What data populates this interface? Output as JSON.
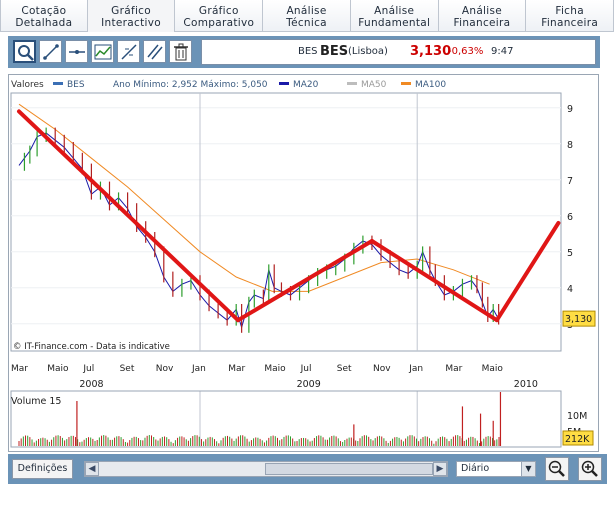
{
  "tabs": [
    {
      "line1": "Cotação",
      "line2": "Detalhada",
      "active": false
    },
    {
      "line1": "Gráfico",
      "line2": "Interactivo",
      "active": true
    },
    {
      "line1": "Gráfico",
      "line2": "Comparativo",
      "active": false
    },
    {
      "line1": "Análise",
      "line2": "Técnica",
      "active": false
    },
    {
      "line1": "Análise",
      "line2": "Fundamental",
      "active": false
    },
    {
      "line1": "Análise",
      "line2": "Financeira",
      "active": false
    },
    {
      "line1": "Ficha",
      "line2": "Financeira",
      "active": false
    }
  ],
  "toolbar": {
    "tools": [
      "zoom-icon",
      "trendline-icon",
      "horizontal-line-icon",
      "indicator-icon",
      "fibonacci-icon",
      "parallel-lines-icon",
      "trash-icon"
    ]
  },
  "quote": {
    "name": "BES",
    "ticker": "BES",
    "market": "(Lisboa)",
    "price": "3,130",
    "change": "-0,63%",
    "time": "9:47"
  },
  "legend": {
    "label": "Valores",
    "series": [
      {
        "name": "BES",
        "color": "#3b6fb5"
      },
      {
        "name": "Ano Mínimo: 2,952 Máximo: 5,050",
        "color": ""
      },
      {
        "name": "MA20",
        "color": "#1a1aa8"
      },
      {
        "name": "MA50",
        "color": "#bdbdbd"
      },
      {
        "name": "MA100",
        "color": "#f08a24"
      }
    ]
  },
  "watermark": "© IT-Finance.com - Data is indicative",
  "volume_label": "Volume 15",
  "price_tag": "3,130",
  "volume_tag": "212K",
  "chart_data": {
    "type": "line",
    "y_ticks": [
      "9",
      "8",
      "7",
      "6",
      "5",
      "4",
      "3"
    ],
    "ylim": [
      2.5,
      9.5
    ],
    "volume_ticks": [
      "10M",
      "5M"
    ],
    "x_month_labels": [
      "Mar",
      "Maio",
      "Jul",
      "Set",
      "Nov",
      "Jan",
      "Mar",
      "Maio",
      "Jul",
      "Set",
      "Nov",
      "Jan",
      "Mar",
      "Maio"
    ],
    "x_year_labels": [
      "2008",
      "2009",
      "2010"
    ],
    "x_months": [
      0,
      2,
      4,
      6,
      8,
      10,
      12,
      14,
      16,
      18,
      20,
      22,
      24,
      26
    ],
    "year_label_months": [
      4,
      16,
      28
    ],
    "year_divider_months": [
      10,
      22
    ],
    "price_path": [
      {
        "x": 0,
        "y": 7.4
      },
      {
        "x": 0.3,
        "y": 7.6
      },
      {
        "x": 0.6,
        "y": 7.8
      },
      {
        "x": 1.0,
        "y": 8.2
      },
      {
        "x": 1.5,
        "y": 8.3
      },
      {
        "x": 2.0,
        "y": 8.1
      },
      {
        "x": 2.5,
        "y": 7.9
      },
      {
        "x": 3.0,
        "y": 7.6
      },
      {
        "x": 3.5,
        "y": 7.3
      },
      {
        "x": 4.0,
        "y": 6.6
      },
      {
        "x": 4.5,
        "y": 6.8
      },
      {
        "x": 5.0,
        "y": 6.3
      },
      {
        "x": 5.5,
        "y": 6.5
      },
      {
        "x": 6.0,
        "y": 6.2
      },
      {
        "x": 6.5,
        "y": 5.7
      },
      {
        "x": 7.0,
        "y": 5.4
      },
      {
        "x": 7.5,
        "y": 5.0
      },
      {
        "x": 8.0,
        "y": 4.3
      },
      {
        "x": 8.5,
        "y": 3.9
      },
      {
        "x": 9.0,
        "y": 4.1
      },
      {
        "x": 9.5,
        "y": 4.2
      },
      {
        "x": 10.0,
        "y": 3.8
      },
      {
        "x": 10.5,
        "y": 3.5
      },
      {
        "x": 11.0,
        "y": 3.3
      },
      {
        "x": 11.5,
        "y": 3.1
      },
      {
        "x": 12.0,
        "y": 3.4
      },
      {
        "x": 12.3,
        "y": 2.9
      },
      {
        "x": 12.7,
        "y": 3.6
      },
      {
        "x": 13.0,
        "y": 3.8
      },
      {
        "x": 13.5,
        "y": 3.7
      },
      {
        "x": 13.8,
        "y": 4.5
      },
      {
        "x": 14.1,
        "y": 4.0
      },
      {
        "x": 14.5,
        "y": 3.9
      },
      {
        "x": 15.0,
        "y": 3.8
      },
      {
        "x": 15.5,
        "y": 4.0
      },
      {
        "x": 16.0,
        "y": 4.2
      },
      {
        "x": 16.5,
        "y": 4.4
      },
      {
        "x": 17.0,
        "y": 4.5
      },
      {
        "x": 17.5,
        "y": 4.6
      },
      {
        "x": 18.0,
        "y": 4.8
      },
      {
        "x": 18.5,
        "y": 5.1
      },
      {
        "x": 19.0,
        "y": 5.3
      },
      {
        "x": 19.5,
        "y": 5.2
      },
      {
        "x": 20.0,
        "y": 4.9
      },
      {
        "x": 20.5,
        "y": 4.7
      },
      {
        "x": 21.0,
        "y": 4.5
      },
      {
        "x": 21.5,
        "y": 4.4
      },
      {
        "x": 22.0,
        "y": 4.6
      },
      {
        "x": 22.3,
        "y": 5.0
      },
      {
        "x": 22.7,
        "y": 4.5
      },
      {
        "x": 23.0,
        "y": 4.2
      },
      {
        "x": 23.5,
        "y": 3.8
      },
      {
        "x": 24.0,
        "y": 3.9
      },
      {
        "x": 24.5,
        "y": 4.1
      },
      {
        "x": 25.0,
        "y": 4.2
      },
      {
        "x": 25.3,
        "y": 4.0
      },
      {
        "x": 25.6,
        "y": 3.6
      },
      {
        "x": 25.9,
        "y": 3.2
      },
      {
        "x": 26.2,
        "y": 3.4
      },
      {
        "x": 26.5,
        "y": 3.13
      }
    ],
    "ma100_path": [
      {
        "x": 0,
        "y": 9.1
      },
      {
        "x": 2,
        "y": 8.4
      },
      {
        "x": 4,
        "y": 7.6
      },
      {
        "x": 6,
        "y": 6.8
      },
      {
        "x": 8,
        "y": 5.9
      },
      {
        "x": 10,
        "y": 5.0
      },
      {
        "x": 12,
        "y": 4.3
      },
      {
        "x": 14,
        "y": 3.9
      },
      {
        "x": 16,
        "y": 3.9
      },
      {
        "x": 18,
        "y": 4.3
      },
      {
        "x": 20,
        "y": 4.7
      },
      {
        "x": 22,
        "y": 4.8
      },
      {
        "x": 24,
        "y": 4.5
      },
      {
        "x": 26,
        "y": 4.1
      }
    ],
    "annotations": [
      {
        "type": "trendline",
        "from": {
          "x": 0,
          "y": 8.9
        },
        "to": {
          "x": 12.1,
          "y": 3.1
        }
      },
      {
        "type": "trendline",
        "from": {
          "x": 12.1,
          "y": 3.1
        },
        "to": {
          "x": 19.5,
          "y": 5.3
        }
      },
      {
        "type": "trendline",
        "from": {
          "x": 19.5,
          "y": 5.3
        },
        "to": {
          "x": 26.4,
          "y": 3.1
        }
      },
      {
        "type": "trendline",
        "from": {
          "x": 26.4,
          "y": 3.1
        },
        "to": {
          "x": 29.8,
          "y": 5.8
        }
      }
    ],
    "volume_spikes": [
      {
        "x": 3.2,
        "v": 12.5
      },
      {
        "x": 18.5,
        "v": 6
      },
      {
        "x": 24.5,
        "v": 11
      },
      {
        "x": 25.5,
        "v": 9
      },
      {
        "x": 26.2,
        "v": 7
      },
      {
        "x": 26.6,
        "v": 15
      }
    ]
  },
  "bottom": {
    "defs_label": "Definições",
    "interval": "Diário"
  }
}
